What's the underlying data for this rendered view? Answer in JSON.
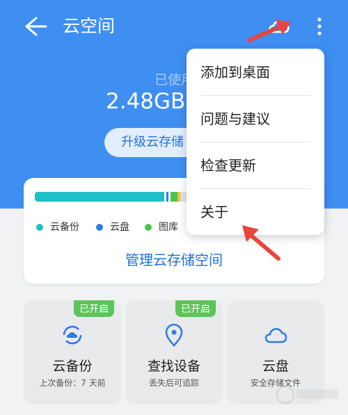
{
  "header": {
    "title": "云空间",
    "back_icon": "arrow-left-icon",
    "sync_icon": "cloud-sync-icon",
    "more_icon": "more-vertical-icon"
  },
  "usage": {
    "label": "已使用",
    "value": "2.48GB",
    "upgrade_label": "升级云存储"
  },
  "storage": {
    "manage_label": "管理云存储空间",
    "legend": [
      {
        "label": "云备份",
        "color": "#1fbfc7"
      },
      {
        "label": "云盘",
        "color": "#2f7be6"
      },
      {
        "label": "图库",
        "color": "#4cc44f"
      }
    ]
  },
  "menu": {
    "items": [
      "添加到桌面",
      "问题与建议",
      "检查更新",
      "关于"
    ]
  },
  "tiles": [
    {
      "name": "云备份",
      "desc": "上次备份：7 天前",
      "badge": "已开启",
      "icon": "cloud-backup-icon"
    },
    {
      "name": "查找设备",
      "desc": "丢失后可追踪",
      "badge": "已开启",
      "icon": "location-pin-icon"
    },
    {
      "name": "云盘",
      "desc": "安全存储文件",
      "badge": "",
      "icon": "cloud-icon"
    }
  ],
  "colors": {
    "hero": "#3f8ef2",
    "accent": "#1e6fd9",
    "badge": "#5cc55a",
    "annotation_arrow": "#e8453c"
  }
}
